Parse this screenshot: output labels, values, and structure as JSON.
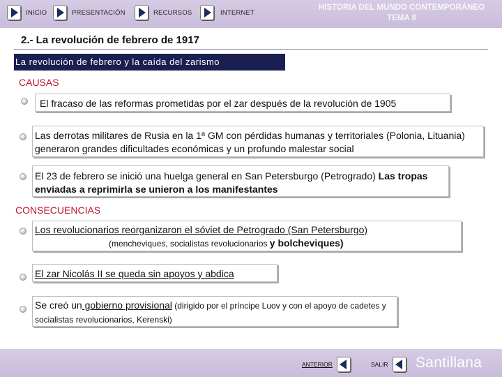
{
  "nav": {
    "inicio": "INICIO",
    "presentacion": "PRESENTACIÓN",
    "recursos": "RECURSOS",
    "internet": "INTERNET"
  },
  "course": {
    "line1": "HISTORIA DEL MUNDO CONTEMPORÁNEO",
    "line2": "TEMA 8"
  },
  "section": {
    "title": "2.- La revolución de febrero de 1917",
    "subtitle": "La revolución de febrero y la caída del zarismo"
  },
  "causas": {
    "label": "CAUSAS",
    "items": [
      {
        "text": " El fracaso de las reformas prometidas por el zar después de la revolución de 1905"
      },
      {
        "text": " Las derrotas militares de Rusia en la 1ª GM con pérdidas humanas y territoriales (Polonia, Lituania) generaron grandes dificultades económicas y un profundo malestar social"
      },
      {
        "text_a": "El 23 de febrero se inició una huelga general en San Petersburgo (Petrogrado) ",
        "text_b": "Las tropas enviadas a reprimirla se unieron a los manifestantes"
      }
    ]
  },
  "consecuencias": {
    "label": "CONSECUENCIAS",
    "items": [
      {
        "line1": "Los revolucionarios reorganizaron el sóviet de Petrogrado (San Petersburgo)",
        "line2_small": "(mencheviques, socialistas revolucionarios ",
        "line2_end": "y bolcheviques)"
      },
      {
        "text": "El zar Nicolás II se queda sin apoyos y abdica"
      },
      {
        "p1": "Se creó un",
        "p2": " gobierno provisional",
        "p3": " (dirigido por el príncipe Luov y con el apoyo de cadetes y socialistas revolucionarios, Kerenski)"
      }
    ]
  },
  "footer": {
    "anterior": "ANTERIOR",
    "salir": "SALIR",
    "brand": "Santillana"
  },
  "colors": {
    "nav_band": "#c9bddb",
    "subtitle_bg": "#1a1f52",
    "group_label": "#c0142a"
  },
  "icons": [
    "play-right-icon",
    "bullet-icon",
    "play-left-icon"
  ]
}
